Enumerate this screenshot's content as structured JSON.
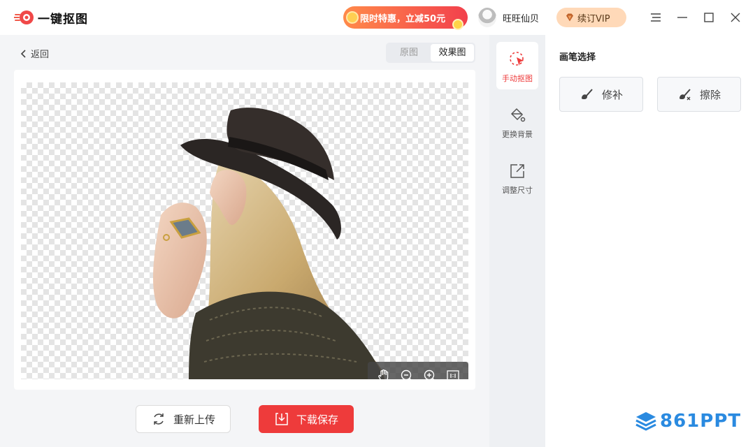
{
  "app": {
    "title": "一键抠图"
  },
  "promo": {
    "label": "限时特惠，立减50元"
  },
  "user": {
    "name": "旺旺仙贝"
  },
  "vip": {
    "label": "续订VIP"
  },
  "nav": {
    "back_label": "返回"
  },
  "view_toggle": {
    "options": [
      "原图",
      "效果图"
    ],
    "selected": "效果图"
  },
  "zoom_tools": [
    "hand-icon",
    "zoom-out-icon",
    "zoom-in-icon",
    "actual-size-icon"
  ],
  "actions": {
    "reupload_label": "重新上传",
    "save_label": "下载保存"
  },
  "tools": [
    {
      "label": "手动抠图",
      "icon": "cursor-click-icon",
      "active": true
    },
    {
      "label": "更换背景",
      "icon": "paint-bucket-icon",
      "active": false
    },
    {
      "label": "调整尺寸",
      "icon": "resize-icon",
      "active": false
    }
  ],
  "brush_panel": {
    "title": "画笔选择",
    "repair_label": "修补",
    "erase_label": "擦除"
  },
  "watermark": {
    "text": "861PPT"
  },
  "colors": {
    "accent_red": "#ee3b3b",
    "vip_bg": "#ffd9b8",
    "watermark_blue": "#2a8ae0"
  }
}
